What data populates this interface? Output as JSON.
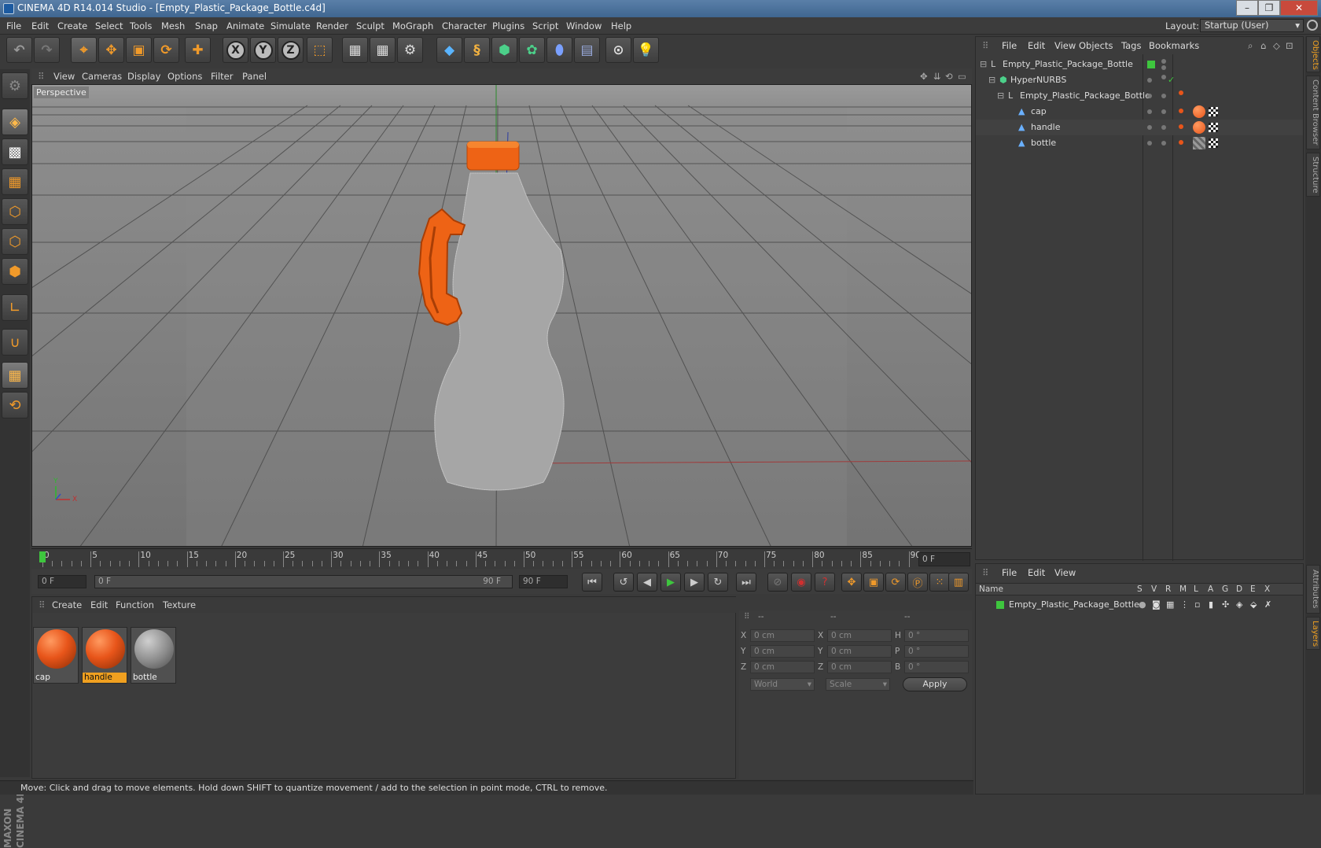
{
  "window": {
    "title": "CINEMA 4D R14.014 Studio - [Empty_Plastic_Package_Bottle.c4d]",
    "minimize": "–",
    "maximize": "❐",
    "close": "✕"
  },
  "menubar": {
    "items": [
      "File",
      "Edit",
      "Create",
      "Select",
      "Tools",
      "Mesh",
      "Snap",
      "Animate",
      "Simulate",
      "Render",
      "Sculpt",
      "MoGraph",
      "Character",
      "Plugins",
      "Script",
      "Window",
      "Help"
    ],
    "layout_label": "Layout:",
    "layout_value": "Startup (User)"
  },
  "viewport": {
    "menu": [
      "View",
      "Cameras",
      "Display",
      "Options",
      "Filter",
      "Panel"
    ],
    "camera_label": "Perspective",
    "axis_labels": {
      "x": "X",
      "y": "Y"
    }
  },
  "timeline": {
    "ticks": [
      "0",
      "5",
      "10",
      "15",
      "20",
      "25",
      "30",
      "35",
      "40",
      "45",
      "50",
      "55",
      "60",
      "65",
      "70",
      "75",
      "80",
      "85",
      "90"
    ],
    "current_frame": "0 F",
    "start_field": "0 F",
    "range_start": "0 F",
    "range_end": "90 F",
    "end_field": "90 F"
  },
  "materials": {
    "menu": [
      "Create",
      "Edit",
      "Function",
      "Texture"
    ],
    "items": [
      {
        "name": "cap",
        "color": "#e8551a",
        "selected": false
      },
      {
        "name": "handle",
        "color": "#e8551a",
        "selected": true
      },
      {
        "name": "bottle",
        "color": "#9a9a9a",
        "selected": false
      }
    ]
  },
  "coordinates": {
    "header": [
      "--",
      "--",
      "--"
    ],
    "rows": [
      {
        "l1": "X",
        "v1": "0 cm",
        "l2": "X",
        "v2": "0 cm",
        "l3": "H",
        "v3": "0 °"
      },
      {
        "l1": "Y",
        "v1": "0 cm",
        "l2": "Y",
        "v2": "0 cm",
        "l3": "P",
        "v3": "0 °"
      },
      {
        "l1": "Z",
        "v1": "0 cm",
        "l2": "Z",
        "v2": "0 cm",
        "l3": "B",
        "v3": "0 °"
      }
    ],
    "mode1": "World",
    "mode2": "Scale",
    "apply": "Apply"
  },
  "objects": {
    "menu": [
      "File",
      "Edit",
      "View",
      "Objects",
      "Tags",
      "Bookmarks"
    ],
    "rows": [
      {
        "name": "Empty_Plastic_Package_Bottle",
        "indent": 0
      },
      {
        "name": "HyperNURBS",
        "indent": 1
      },
      {
        "name": "Empty_Plastic_Package_Bottle",
        "indent": 2
      },
      {
        "name": "cap",
        "indent": 3
      },
      {
        "name": "handle",
        "indent": 3
      },
      {
        "name": "bottle",
        "indent": 3
      }
    ]
  },
  "layers": {
    "menu": [
      "File",
      "Edit",
      "View"
    ],
    "columns": [
      "Name",
      "S",
      "V",
      "R",
      "M",
      "L",
      "A",
      "G",
      "D",
      "E",
      "X"
    ],
    "rows": [
      {
        "name": "Empty_Plastic_Package_Bottle",
        "color": "#3ec63e"
      }
    ]
  },
  "side_tabs": [
    "Objects",
    "Content Browser",
    "Structure",
    "Attributes",
    "Layers"
  ],
  "status": "Move: Click and drag to move elements. Hold down SHIFT to quantize movement / add to the selection in point mode, CTRL to remove.",
  "brand": "MAXON CINEMA 4D",
  "colors": {
    "accent": "#f09a2a",
    "orange": "#e8551a",
    "green_tag": "#3ec63e"
  }
}
